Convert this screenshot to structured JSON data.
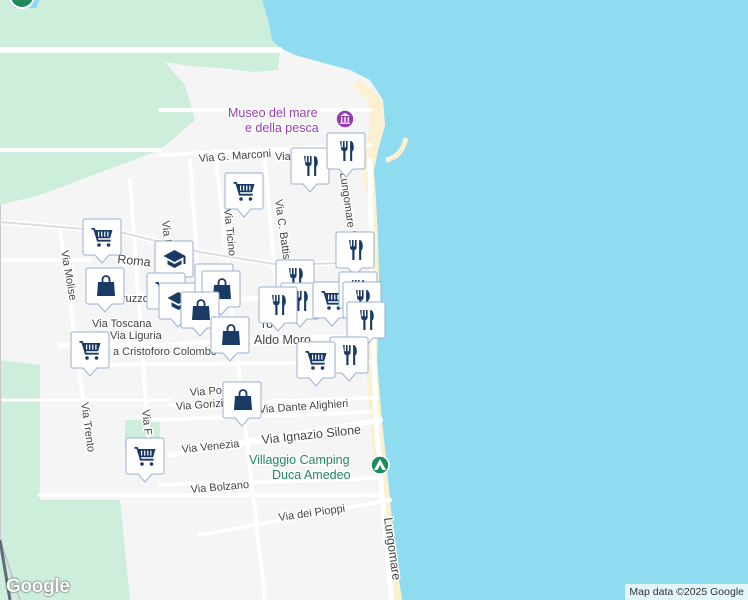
{
  "map": {
    "labels": {
      "museum": [
        "Museo del mare",
        "e della pesca"
      ],
      "camping": [
        "Villaggio Camping",
        "Duca Amedeo"
      ],
      "streets": {
        "marconi": "Via G. Marconi",
        "marconi_cont": "Via",
        "roma": "Roma",
        "abruzzo": "ruzzo",
        "toscana": "Via Toscana",
        "liguria": "Via Liguria",
        "colombo": "a Cristoforo Colombo",
        "aldo_moro": "Aldo Moro",
        "moro_center": "ro",
        "molise": "Via Molise",
        "trento": "Via Trento",
        "ticino": "Via Ticino",
        "battisti": "Via C. Battisti",
        "via_p": "Via P",
        "via_f": "Via F",
        "polo": "Via Pola",
        "gorizia": "Via Gorizia",
        "dante": "Via Dante Alighieri",
        "venezia": "Via Venezia",
        "silone": "Via Ignazio Silone",
        "bolzano": "Via Bolzano",
        "pioppi": "Via dei Pioppi",
        "lungomare_europa": "Lungomare Europa",
        "lungomare": "Lungomare"
      }
    },
    "icons": {
      "museum": "museum-icon",
      "camping": "campground-icon",
      "restaurant": "restaurant-icon",
      "shopping_cart": "shopping-cart-icon",
      "shopping_bag": "shopping-bag-icon",
      "school": "school-icon"
    },
    "colors": {
      "water": "#8fdbef",
      "land": "#f5f5f6",
      "park": "#cdeedb",
      "beach": "#fbf0cf",
      "marker_fill": "#ffffff",
      "marker_icon": "#1a3a66",
      "marker_border": "#9ab0d0"
    }
  },
  "footer": {
    "logo": "Google",
    "attribution": "Map data ©2025 Google"
  }
}
